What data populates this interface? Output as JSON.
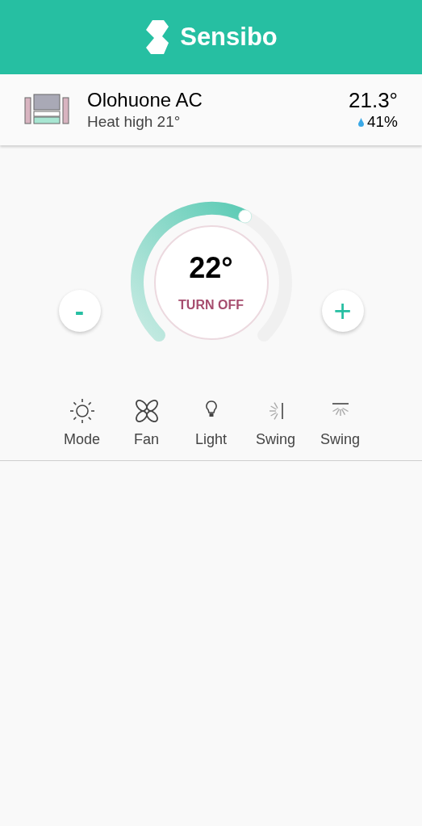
{
  "header": {
    "brand": "Sensibo"
  },
  "device": {
    "name": "Olohuone AC",
    "status": "Heat high 21°",
    "temperature": "21.3°",
    "humidity": "41%"
  },
  "thermostat": {
    "minus": "-",
    "plus": "+",
    "target": "22°",
    "power_button": "TURN OFF"
  },
  "controls": [
    {
      "kind": "mode",
      "label": "Mode"
    },
    {
      "kind": "fan",
      "label": "Fan"
    },
    {
      "kind": "light",
      "label": "Light"
    },
    {
      "kind": "swing_vertical",
      "label": "Swing"
    },
    {
      "kind": "swing_horizontal",
      "label": "Swing"
    }
  ]
}
